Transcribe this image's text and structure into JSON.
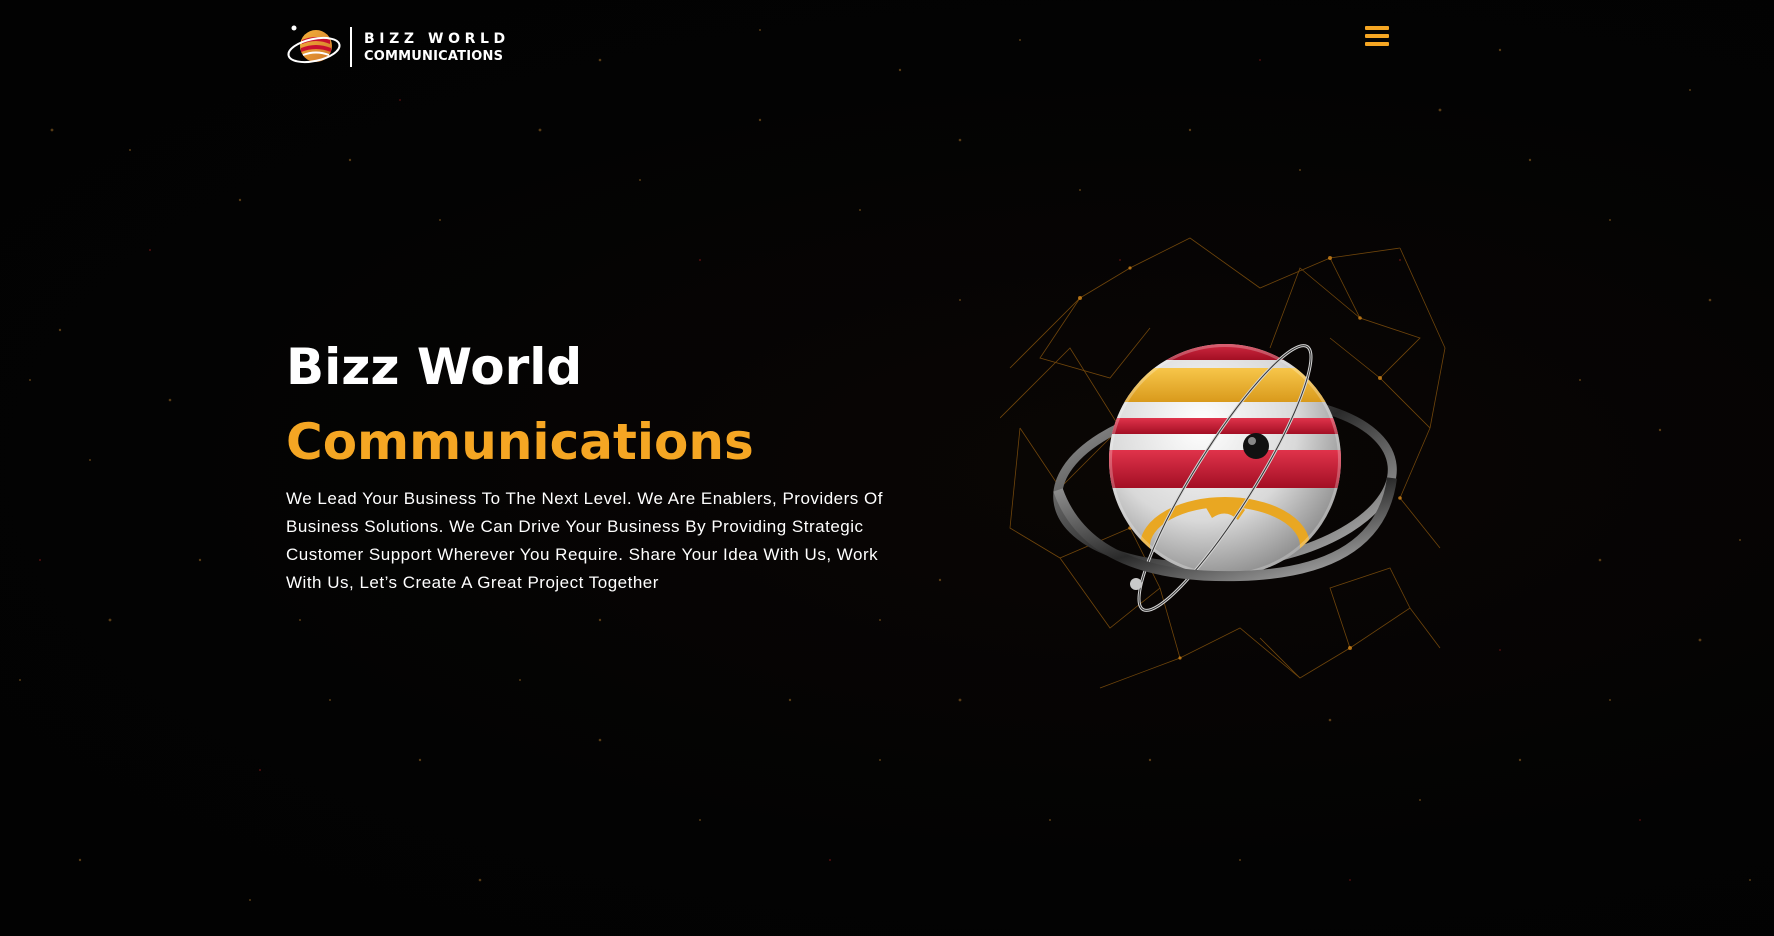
{
  "header": {
    "logo_line1": "BIZZ WORLD",
    "logo_line2": "COMMUNICATIONS",
    "menu_icon": "hamburger-menu-icon"
  },
  "hero": {
    "title_line1": "Bizz World",
    "title_line2": "Communications",
    "description": "We Lead Your Business To The Next Level. We Are Enablers, Providers Of Business Solutions. We Can Drive Your Business By Providing Strategic Customer Support Wherever You Require. Share Your Idea With Us, Work With Us, Let’s Create A Great Project Together",
    "graphic_icon": "planet-globe-icon"
  },
  "colors": {
    "background": "#030303",
    "accent": "#f5a623",
    "text": "#ffffff",
    "globe_red": "#c8102e"
  }
}
